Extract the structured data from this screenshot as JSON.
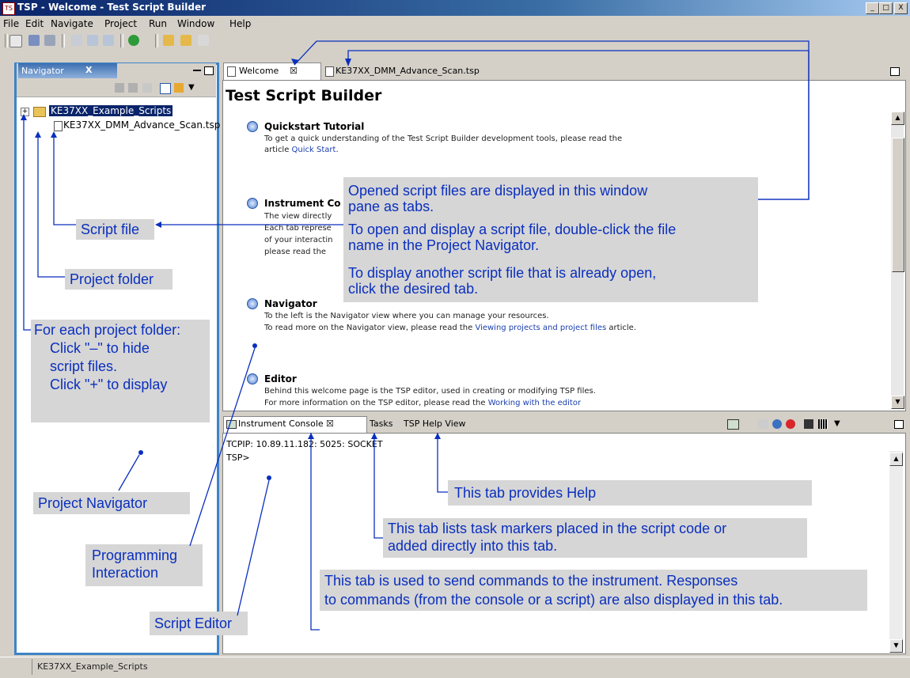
{
  "window": {
    "title": "TSP - Welcome - Test Script Builder",
    "min": "_",
    "max": "□",
    "close": "X"
  },
  "menu": [
    "File",
    "Edit",
    "Navigate",
    "Project",
    "Run",
    "Window",
    "Help"
  ],
  "navigator": {
    "tab_label": "Navigator",
    "tab_close": "X",
    "items": [
      {
        "expander": "+",
        "label": "KE37XX_Example_Scripts"
      },
      {
        "label": "KE37XX_DMM_Advance_Scan.tsp"
      }
    ]
  },
  "editor": {
    "tabs": [
      {
        "label": "Welcome",
        "close": "☒"
      },
      {
        "label": "KE37XX_DMM_Advance_Scan.tsp"
      }
    ],
    "page_title": "Test Script Builder",
    "sections": [
      {
        "title": "Quickstart Tutorial",
        "body1": "To get a quick understanding of the Test Script Builder development tools, please read the",
        "body2_prefix": "article ",
        "link": "Quick Start",
        "body2_suffix": "."
      },
      {
        "title": "Instrument Co",
        "lines": [
          "The view directly",
          "Each tab represe",
          "of your interactin",
          "please read the"
        ]
      },
      {
        "title": "Navigator",
        "body1": "To the left is the Navigator view where you can manage your resources.",
        "body2_prefix": "To read more on the Navigator view, please read the ",
        "link": "Viewing projects and project files",
        "body2_suffix": " article."
      },
      {
        "title": "Editor",
        "body1": "Behind this welcome page is the TSP editor, used in creating or modifying TSP files.",
        "body2_prefix": "For more information on the TSP editor, please read the ",
        "link": "Working with the editor",
        "body2_suffix": ""
      }
    ]
  },
  "console": {
    "tabs": [
      {
        "label": "Instrument Console",
        "close": "☒"
      },
      {
        "label": "Tasks"
      },
      {
        "label": "TSP Help View"
      }
    ],
    "connection": "TCPIP: 10.89.11.182: 5025: SOCKET",
    "prompt": "TSP>"
  },
  "annotations": {
    "opened": [
      "Opened script files are displayed in this window",
      "pane as tabs."
    ],
    "to_open": [
      "To open and display a script file, double-click the file",
      "name in the Project Navigator."
    ],
    "to_display": [
      "To display another script file that is already open,",
      "click the desired tab."
    ],
    "script_file": "Script file",
    "project_folder": "Project folder",
    "each_folder": [
      "For each project folder:",
      "Click \"–\" to hide",
      "script files.",
      "Click \"+\" to display"
    ],
    "project_navigator": "Project Navigator",
    "programming": [
      "Programming",
      "Interaction"
    ],
    "script_editor": "Script Editor",
    "help_tab": "This tab provides Help",
    "tasks_tab": [
      "This tab lists task markers placed in the script code or",
      "added directly into this tab."
    ],
    "console_tab": [
      "This tab is used to send commands to the instrument. Responses",
      "to commands (from the console or a script) are also displayed in this tab."
    ]
  },
  "status": {
    "text": "KE37XX_Example_Scripts"
  },
  "colors": {
    "title_bar": "#0a246a",
    "annotation_text": "#0a2fbe",
    "annotation_bg": "#d6d6d6",
    "navigator_border": "#3d84c6"
  }
}
